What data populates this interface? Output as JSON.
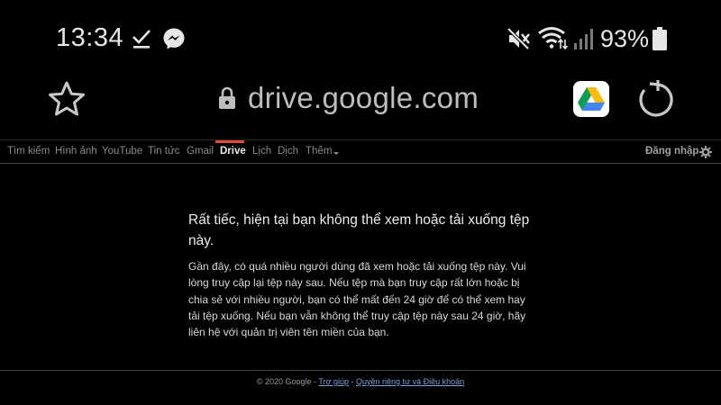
{
  "status_bar": {
    "time": "13:34",
    "battery_percent": "93%",
    "icons": [
      "check-icon",
      "messenger-icon",
      "mute-icon",
      "wifi-icon",
      "signal-icon",
      "battery-icon"
    ]
  },
  "browser": {
    "url": "drive.google.com",
    "icons": [
      "star-icon",
      "lock-icon",
      "google-drive-icon",
      "refresh-icon"
    ]
  },
  "gbar": {
    "links": [
      {
        "label": "Tìm kiếm"
      },
      {
        "label": "Hình ảnh"
      },
      {
        "label": "YouTube"
      },
      {
        "label": "Tin tức"
      },
      {
        "label": "Gmail"
      },
      {
        "label": "Drive",
        "active": true
      },
      {
        "label": "Lịch"
      },
      {
        "label": "Dịch"
      },
      {
        "label": "Thêm"
      }
    ],
    "signin": "Đăng nhập",
    "accent": "#dd4b39"
  },
  "main": {
    "heading": "Rất tiếc, hiện tại bạn không thể xem hoặc tải xuống tệp này.",
    "body": "Gần đây, có quá nhiều người dùng đã xem hoặc tải xuống tệp này. Vui lòng truy cập lại tệp này sau. Nếu tệp mà bạn truy cập rất lớn hoặc bị chia sẻ với nhiều người, bạn có thể mất đến 24 giờ để có thể xem hay tải tệp xuống. Nếu bạn vẫn không thể truy cập tệp này sau 24 giờ, hãy liên hệ với quản trị viên tên miền của bạn."
  },
  "footer": {
    "copyright": "© 2020 Google",
    "sep1": " - ",
    "help": "Trợ giúp",
    "sep2": " - ",
    "privacy_terms": "Quyền riêng tư và Điều khoản",
    "link_color": "#7aa2d6"
  }
}
